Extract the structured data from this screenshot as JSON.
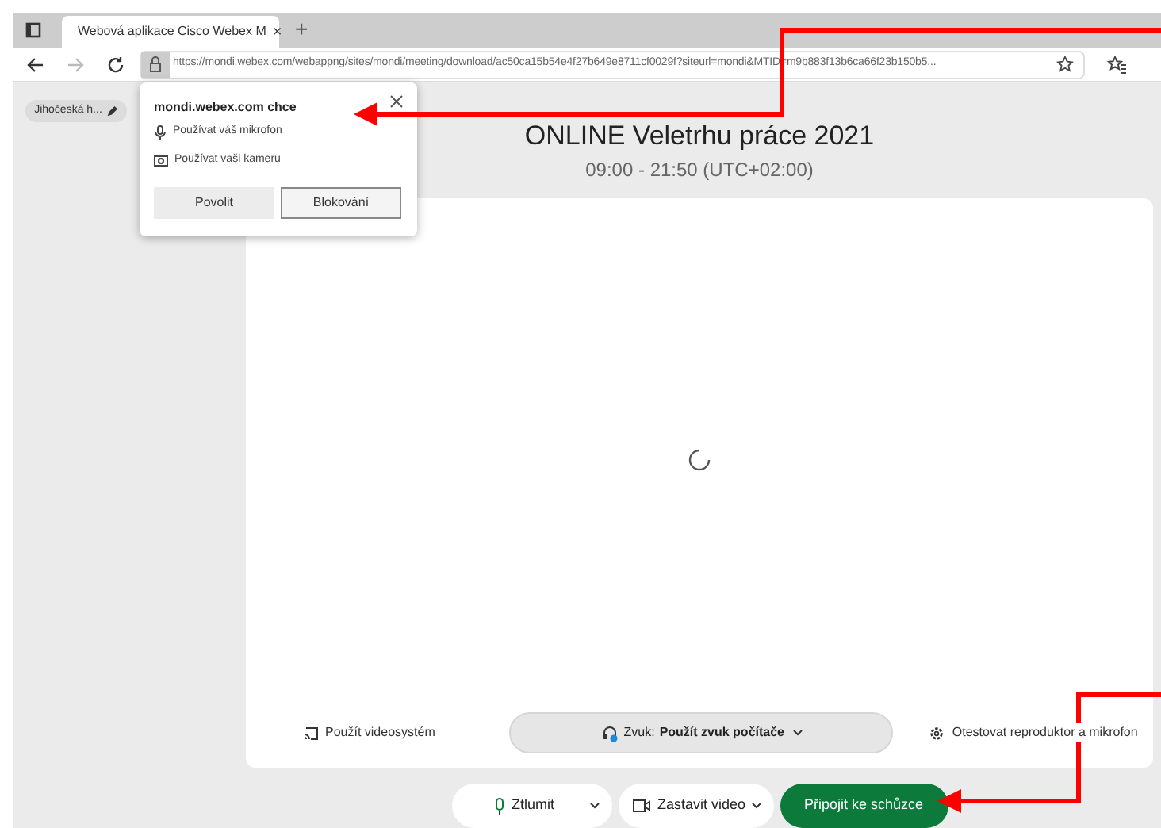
{
  "browser": {
    "tab": {
      "title": "Webová aplikace Cisco Webex M",
      "close": "×"
    },
    "new_tab": "+",
    "url": "https://mondi.webex.com/webappng/sites/mondi/meeting/download/ac50ca15b54e4f27b649e8711cf0029f?siteurl=mondi&MTID=m9b883f13b6ca66f23b150b5..."
  },
  "permission_popup": {
    "title": "mondi.webex.com chce",
    "items": [
      {
        "kind": "microphone",
        "label": "Používat váš mikrofon"
      },
      {
        "kind": "camera",
        "label": "Používat vaši kameru"
      }
    ],
    "buttons": [
      {
        "label": "Povolit",
        "kind": "allow"
      },
      {
        "label": "Blokování",
        "kind": "block"
      }
    ]
  },
  "user_chip": "Jihočeská h...",
  "meeting": {
    "title": "ONLINE Veletrhu práce 2021",
    "time": "09:00 - 21:50 (UTC+02:00)"
  },
  "options": {
    "video_system": "Použít videosystém",
    "audio_label": "Zvuk:",
    "audio_value": "Použít zvuk počítače",
    "test": "Otestovat reproduktor a mikrofon"
  },
  "controls": [
    {
      "kind": "mute",
      "label": "Ztlumit"
    },
    {
      "kind": "video",
      "label": "Zastavit video"
    },
    {
      "kind": "join",
      "label": "Připojit ke schůzce"
    }
  ]
}
